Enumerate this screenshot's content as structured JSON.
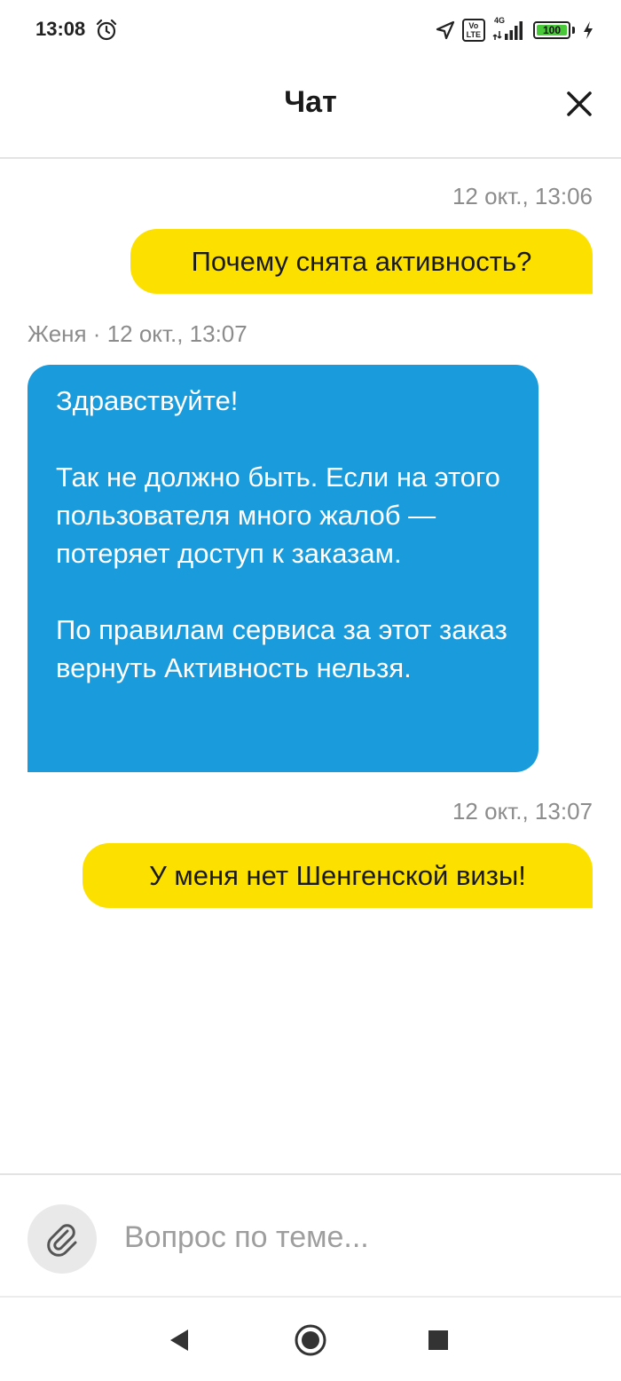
{
  "status_bar": {
    "time": "13:08",
    "battery_level": "100",
    "network": "4G",
    "volte_top": "Vo",
    "volte_bottom": "LTE",
    "icons": [
      "alarm-icon",
      "location-arrow-icon",
      "volte-icon",
      "signal-icon",
      "battery-icon",
      "charging-icon"
    ]
  },
  "header": {
    "title": "Чат",
    "close_icon": "close-icon"
  },
  "messages": [
    {
      "direction": "outgoing",
      "timestamp": "12 окт., 13:06",
      "text": "Почему снята активность?"
    },
    {
      "direction": "incoming",
      "author_line": "Женя · 12 окт., 13:07",
      "paragraphs": [
        "Здравствуйте!",
        "Так не должно быть. Если на этого пользователя много жалоб — потеряет доступ к заказам.",
        "По правилам сервиса за этот заказ вернуть Активность нельзя."
      ]
    },
    {
      "direction": "outgoing",
      "timestamp": "12 окт., 13:07",
      "text": "У меня нет Шенгенской визы!"
    }
  ],
  "input": {
    "placeholder": "Вопрос по теме...",
    "value": "",
    "attach_icon": "paperclip-icon"
  },
  "nav": {
    "icons": [
      "back-triangle-icon",
      "home-circle-icon",
      "recents-square-icon"
    ]
  },
  "colors": {
    "outgoing_bubble": "#fce000",
    "incoming_bubble": "#1a9bdc",
    "timestamp": "#8c8c8c",
    "battery_fill": "#49c93a"
  }
}
